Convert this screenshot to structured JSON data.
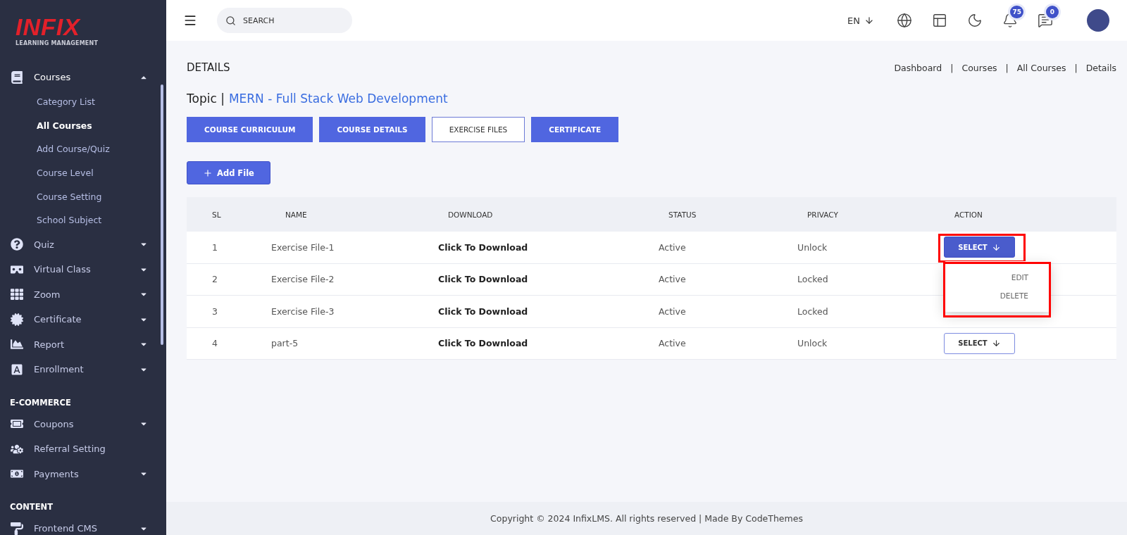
{
  "sidebar": {
    "logo": {
      "title": "INFIX",
      "subtitle": "LEARNING MANAGEMENT"
    },
    "sections": [
      {
        "items": [
          {
            "label": "Courses",
            "expanded": true,
            "children": [
              {
                "label": "Category List",
                "selected": false
              },
              {
                "label": "All Courses",
                "selected": true
              },
              {
                "label": "Add Course/Quiz",
                "selected": false
              },
              {
                "label": "Course Level",
                "selected": false
              },
              {
                "label": "Course Setting",
                "selected": false
              },
              {
                "label": "School Subject",
                "selected": false
              }
            ]
          },
          {
            "label": "Quiz",
            "expanded": false
          },
          {
            "label": "Virtual Class",
            "expanded": false
          },
          {
            "label": "Zoom",
            "expanded": false
          },
          {
            "label": "Certificate",
            "expanded": false
          },
          {
            "label": "Report",
            "expanded": false
          },
          {
            "label": "Enrollment",
            "expanded": false
          }
        ]
      },
      {
        "heading": "E-COMMERCE",
        "items": [
          {
            "label": "Coupons",
            "expanded": false
          },
          {
            "label": "Referral Setting"
          },
          {
            "label": "Payments",
            "expanded": false
          }
        ]
      },
      {
        "heading": "CONTENT",
        "items": [
          {
            "label": "Frontend CMS",
            "expanded": false
          }
        ]
      }
    ]
  },
  "header": {
    "search": {
      "placeholder": "SEARCH"
    },
    "language": "EN",
    "notifications": "75",
    "messages": "0"
  },
  "page": {
    "title": "DETAILS",
    "breadcrumbs": [
      "Dashboard",
      "Courses",
      "All Courses",
      "Details"
    ],
    "breadcrumb_separator": "|",
    "topic_label": "Topic |",
    "topic": "MERN - Full Stack Web Development",
    "tabs": [
      {
        "label": "COURSE CURRICULUM",
        "selected": false
      },
      {
        "label": "COURSE DETAILS",
        "selected": false
      },
      {
        "label": "EXERCISE FILES",
        "selected": true
      },
      {
        "label": "CERTIFICATE",
        "selected": false
      }
    ],
    "add_button": "Add File",
    "table": {
      "columns": [
        "SL",
        "NAME",
        "DOWNLOAD",
        "STATUS",
        "PRIVACY",
        "ACTION"
      ],
      "rows": [
        {
          "sl": "1",
          "name": "Exercise File-1",
          "download": "Click To Download",
          "status": "Active",
          "privacy": "Unlock",
          "action": {
            "label": "SELECT",
            "open": true,
            "highlighted": true,
            "menu": [
              "EDIT",
              "DELETE"
            ],
            "menu_highlighted": true
          }
        },
        {
          "sl": "2",
          "name": "Exercise File-2",
          "download": "Click To Download",
          "status": "Active",
          "privacy": "Locked"
        },
        {
          "sl": "3",
          "name": "Exercise File-3",
          "download": "Click To Download",
          "status": "Active",
          "privacy": "Locked"
        },
        {
          "sl": "4",
          "name": "part-5",
          "download": "Click To Download",
          "status": "Active",
          "privacy": "Unlock",
          "action": {
            "label": "SELECT",
            "open": false
          }
        }
      ]
    }
  },
  "footer": "Copyright © 2024 InfixLMS. All rights reserved | Made By CodeThemes"
}
